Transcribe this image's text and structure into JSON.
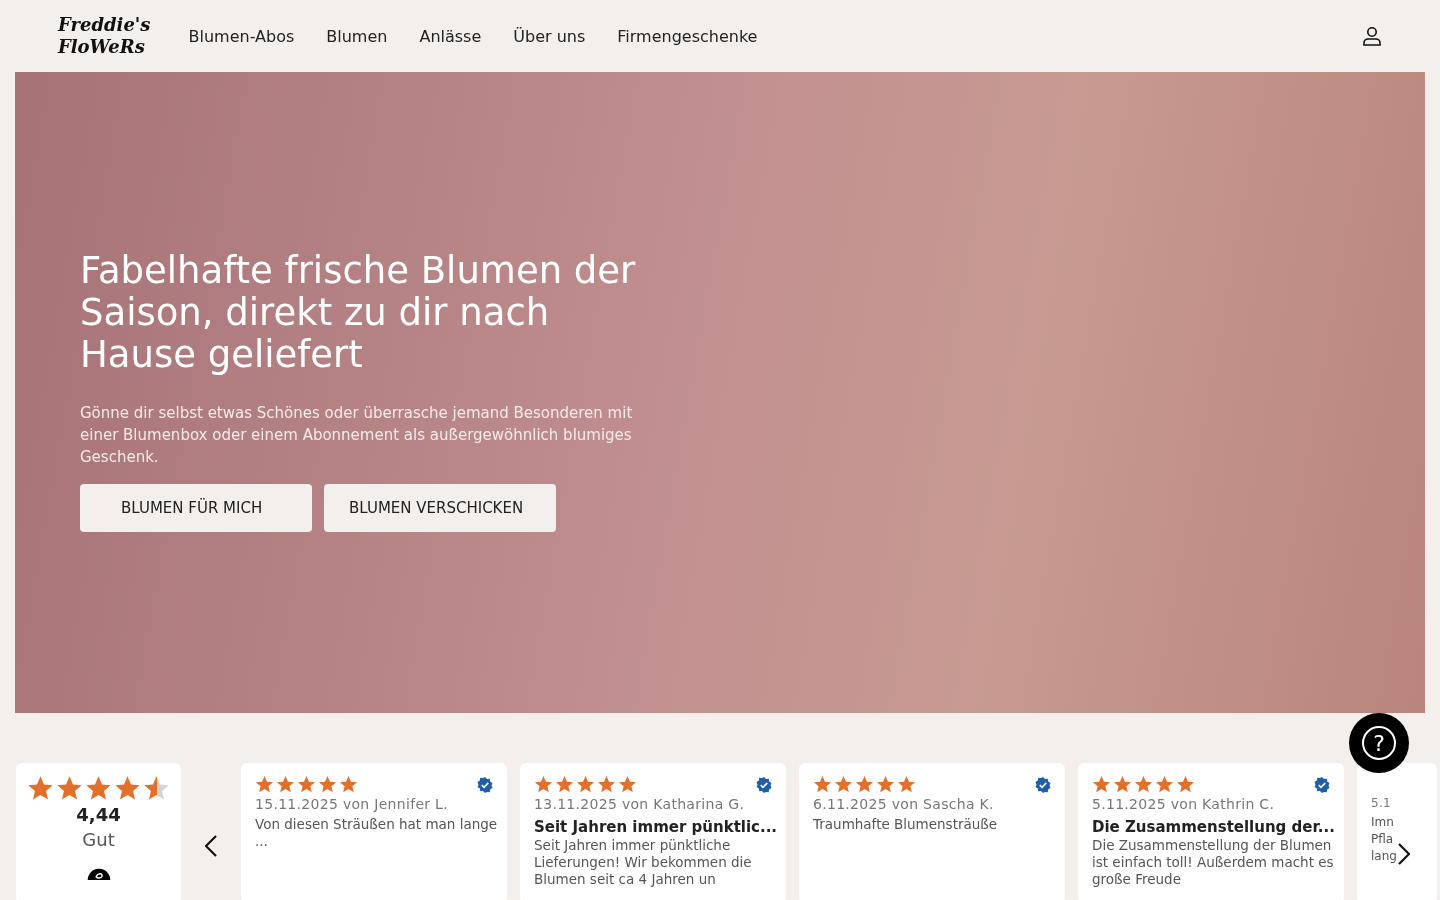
{
  "header": {
    "logo": [
      "Freddie's",
      "FloWeRs"
    ],
    "nav": [
      "Blumen-Abos",
      "Blumen",
      "Anlässe",
      "Über uns",
      "Firmengeschenke"
    ]
  },
  "hero": {
    "title": "Fabelhafte frische Blumen der Saison, direkt zu dir nach Hause geliefert",
    "text": "Gönne dir selbst etwas Schönes oder überrasche jemand Besonderen mit einer Blumenbox oder einem Abonnement als außergewöhnlich blumiges Geschenk.",
    "buttons": [
      "BLUMEN FÜR MICH",
      "BLUMEN VERSCHICKEN"
    ]
  },
  "rating": {
    "stars": 4.5,
    "score": "4,44",
    "label": "Gut"
  },
  "reviews": [
    {
      "stars": 5,
      "meta": "15.11.2025 von Jennifer L.",
      "body": "Von diesen Sträußen hat man lange ..."
    },
    {
      "stars": 5,
      "meta": "13.11.2025 von Katharina G.",
      "title": "Seit Jahren immer pünktlic...",
      "body": "Seit Jahren immer pünktliche Lieferungen! Wir bekommen die Blumen seit ca 4 Jahren un"
    },
    {
      "stars": 5,
      "meta": "6.11.2025 von Sascha K.",
      "body": "Traumhafte Blumensträuße"
    },
    {
      "stars": 5,
      "meta": "5.11.2025 von Kathrin C.",
      "title": "Die Zusammenstellung der...",
      "body": "Die Zusammenstellung der Blumen ist einfach toll! Außerdem macht es große Freude"
    },
    {
      "meta": "5.1",
      "body": "Imn Pfla lang"
    }
  ],
  "help_button": "?"
}
